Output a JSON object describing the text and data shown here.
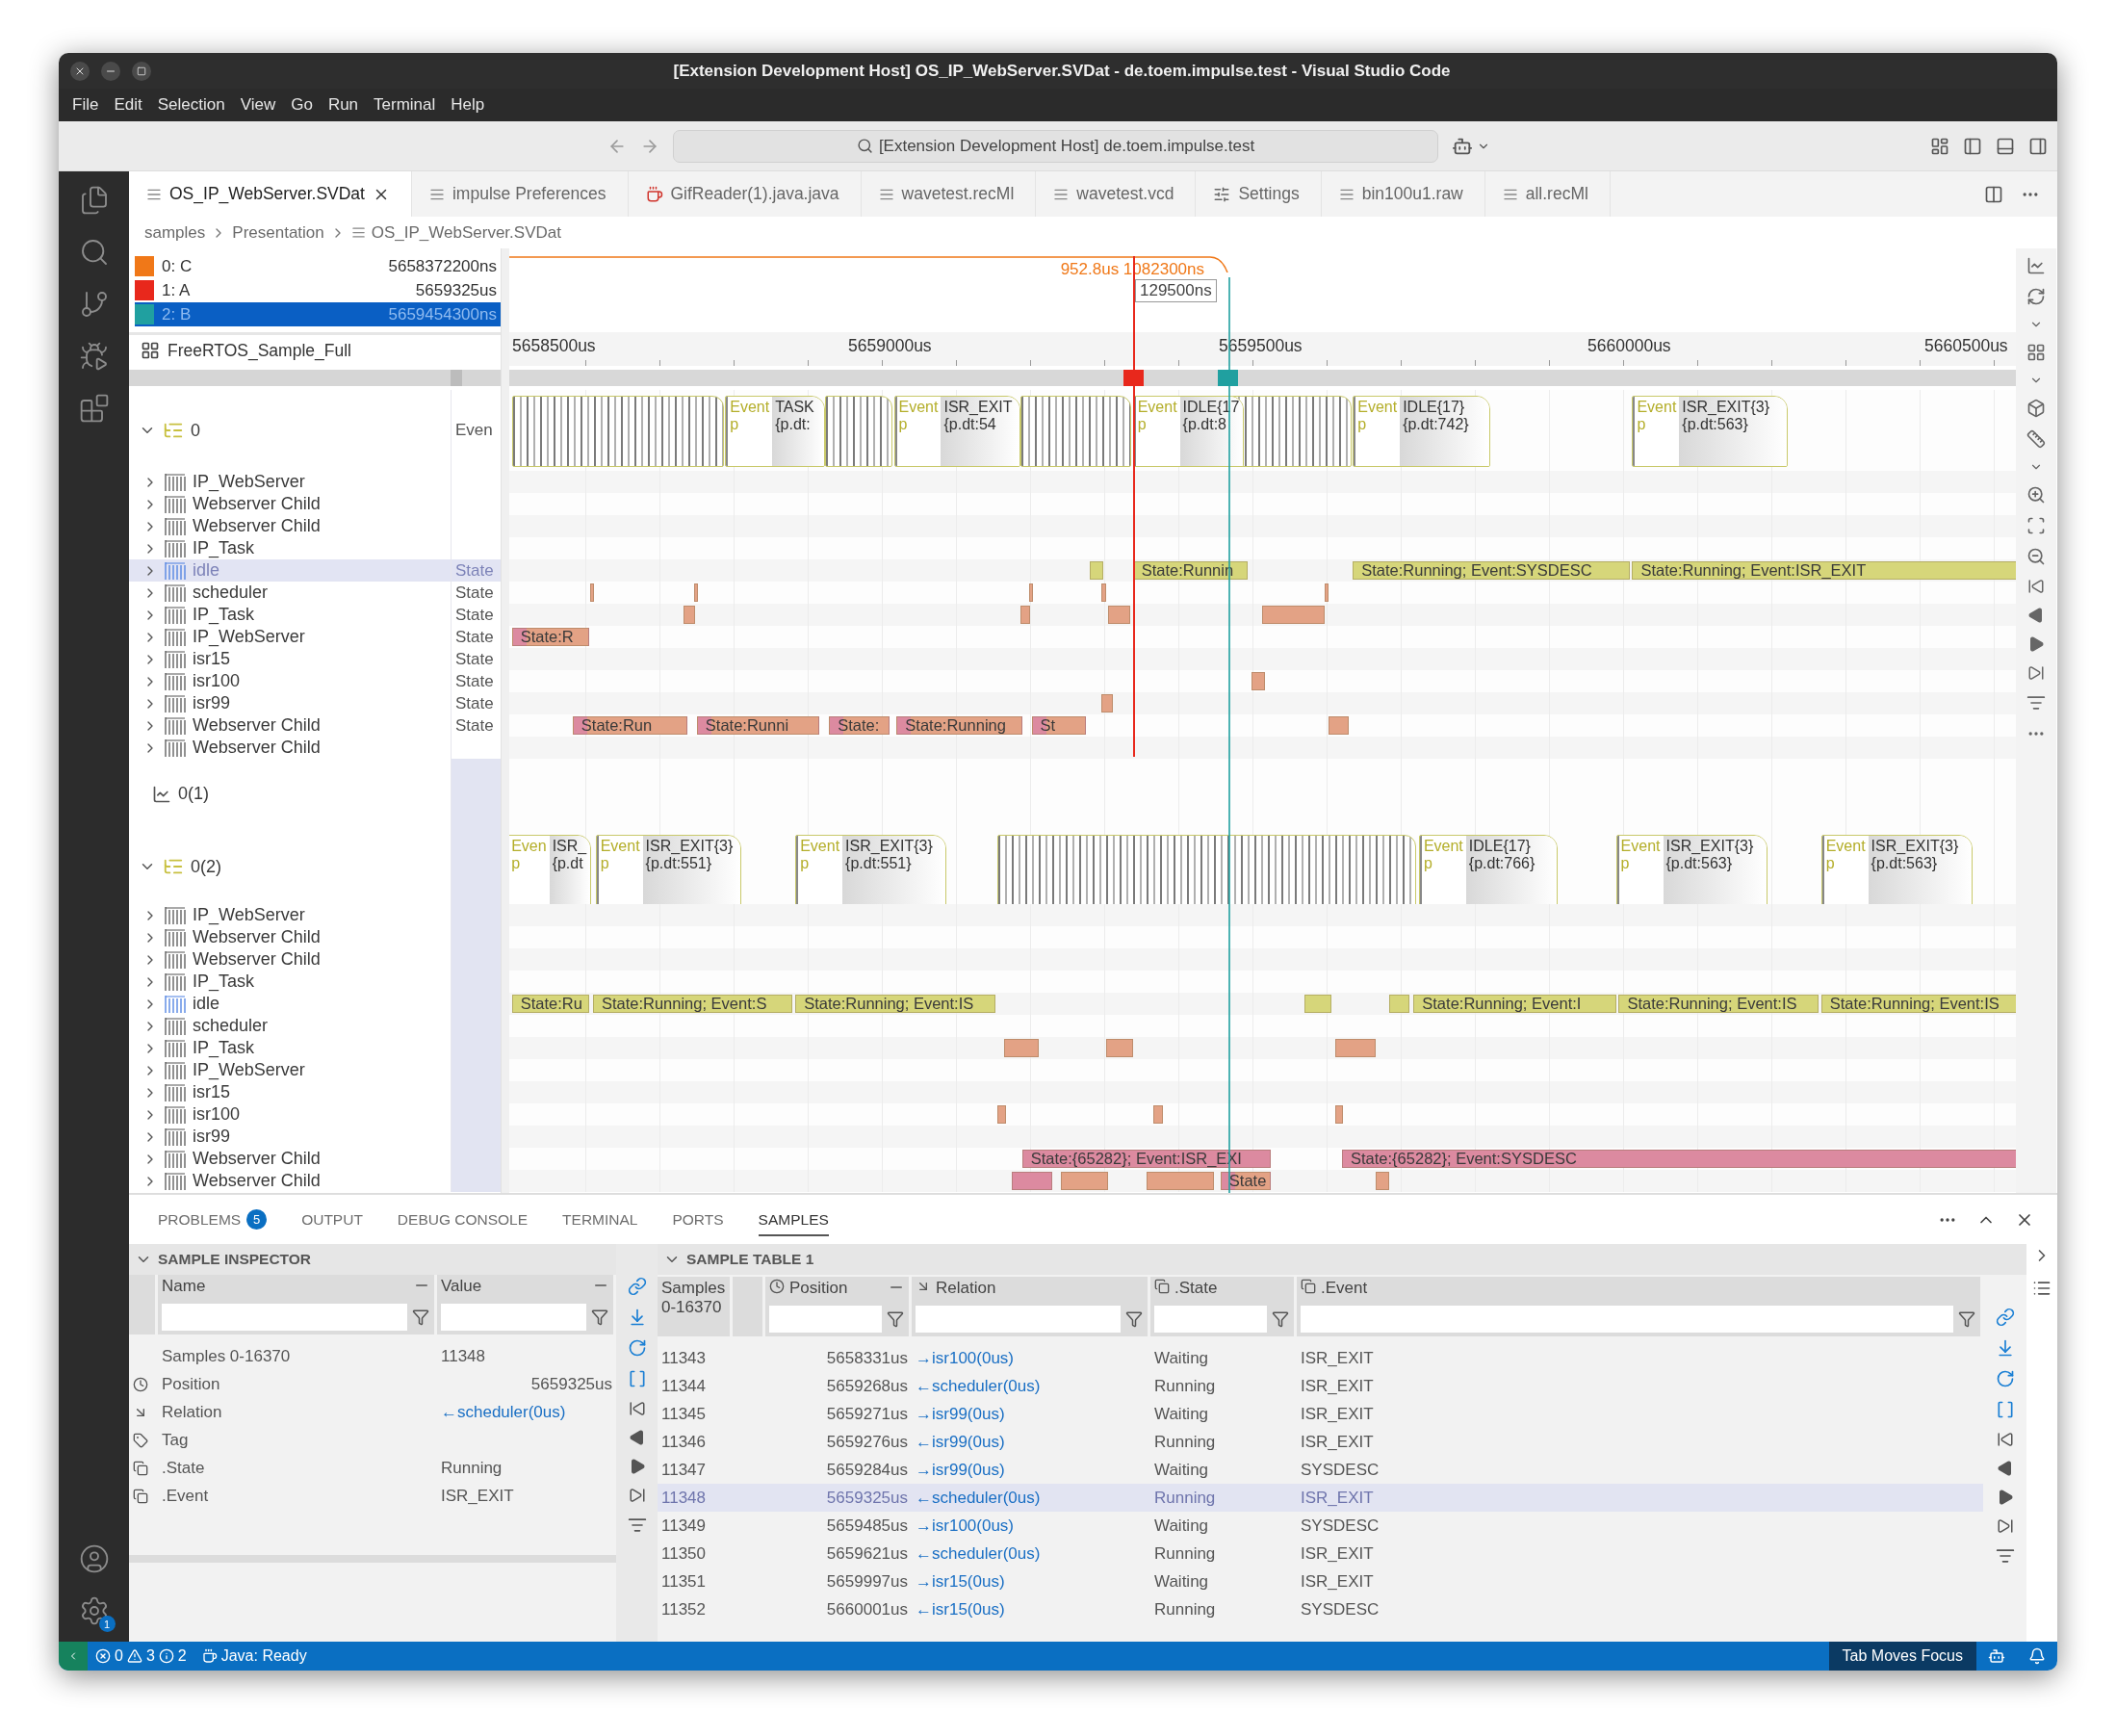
{
  "window": {
    "title": "[Extension Development Host] OS_IP_WebServer.SVDat - de.toem.impulse.test - Visual Studio Code"
  },
  "menu": [
    "File",
    "Edit",
    "Selection",
    "View",
    "Go",
    "Run",
    "Terminal",
    "Help"
  ],
  "command_center": {
    "text": "[Extension Development Host] de.toem.impulse.test"
  },
  "activity_bar": {
    "settings_badge": "1"
  },
  "tabs": [
    {
      "label": "OS_IP_WebServer.SVDat",
      "kind": "data",
      "selected": true
    },
    {
      "label": "impulse Preferences",
      "kind": "data",
      "selected": false
    },
    {
      "label": "GifReader(1).java.java",
      "kind": "java",
      "selected": false
    },
    {
      "label": "wavetest.recMl",
      "kind": "data",
      "selected": false
    },
    {
      "label": "wavetest.vcd",
      "kind": "data",
      "selected": false
    },
    {
      "label": "Settings",
      "kind": "settings",
      "selected": false
    },
    {
      "label": "bin100u1.raw",
      "kind": "data",
      "selected": false
    },
    {
      "label": "all.recMl",
      "kind": "data",
      "selected": false
    }
  ],
  "breadcrumb": [
    "samples",
    "Presentation",
    "OS_IP_WebServer.SVDat"
  ],
  "cursors": [
    {
      "name": "0: C",
      "value": "5658372200ns",
      "color": "#f07818",
      "selected": false
    },
    {
      "name": "1: A",
      "value": "5659325us",
      "color": "#e8281c",
      "selected": false
    },
    {
      "name": "2: B",
      "value": "5659454300ns",
      "color": "#20a0a0",
      "selected": true
    }
  ],
  "cursor_labels": {
    "delta": "952.8us 1082300ns",
    "span": "129500ns"
  },
  "document": {
    "name": "FreeRTOS_Sample_Full"
  },
  "ruler": [
    "5658500us",
    "5659000us",
    "5659500us",
    "5660000us",
    "5660500us"
  ],
  "tracks": [
    {
      "kind": "group",
      "label": "0",
      "expanded": true,
      "value": "Even",
      "events": [
        {
          "tag": "Event",
          "sub": "p",
          "name": "TASK",
          "detail": "{p.dt:"
        },
        {
          "tag": "Event",
          "sub": "p",
          "name": "ISR_EXIT",
          "detail": "{p.dt:54"
        },
        {
          "tag": "Event",
          "sub": "p",
          "name": "IDLE{17",
          "detail": "{p.dt:8"
        },
        {
          "tag": "Event",
          "sub": "p",
          "name": "IDLE{17}",
          "detail": "{p.dt:742}"
        },
        {
          "tag": "Event",
          "sub": "p",
          "name": "ISR_EXIT{3}",
          "detail": "{p.dt:563}"
        }
      ],
      "children": [
        {
          "label": "IP_WebServer",
          "selected": false
        },
        {
          "label": "Webserver Child",
          "selected": false
        },
        {
          "label": "Webserver Child",
          "selected": false
        },
        {
          "label": "IP_Task",
          "selected": false
        },
        {
          "label": "idle",
          "selected": true,
          "value": "State",
          "segments": [
            {
              "label": "State:Runnin",
              "kind": "state"
            },
            {
              "label": "State:Running; Event:SYSDESC",
              "kind": "state"
            },
            {
              "label": "State:Running; Event:ISR_EXIT",
              "kind": "state"
            }
          ]
        },
        {
          "label": "scheduler",
          "selected": false,
          "value": "State"
        },
        {
          "label": "IP_Task",
          "selected": false,
          "value": "State"
        },
        {
          "label": "IP_WebServer",
          "selected": false,
          "value": "State",
          "segments": [
            {
              "label": "State:R",
              "kind": "running"
            }
          ]
        },
        {
          "label": "isr15",
          "selected": false,
          "value": "State"
        },
        {
          "label": "isr100",
          "selected": false,
          "value": "State"
        },
        {
          "label": "isr99",
          "selected": false,
          "value": "State"
        },
        {
          "label": "Webserver Child",
          "selected": false,
          "value": "State",
          "segments": [
            {
              "label": "State:Run",
              "kind": "running"
            },
            {
              "label": "State:Runni",
              "kind": "running"
            },
            {
              "label": "State:",
              "kind": "running"
            },
            {
              "label": "State:Running",
              "kind": "running"
            },
            {
              "label": "St",
              "kind": "running"
            }
          ]
        },
        {
          "label": "Webserver Child",
          "selected": false
        }
      ]
    },
    {
      "kind": "graph",
      "label": "0(1)"
    },
    {
      "kind": "group",
      "label": "0(2)",
      "expanded": true,
      "events": [
        {
          "tag": "Even",
          "sub": "p",
          "name": "ISR_",
          "detail": "{p.dt"
        },
        {
          "tag": "Event",
          "sub": "p",
          "name": "ISR_EXIT{3}",
          "detail": "{p.dt:551}"
        },
        {
          "tag": "Event",
          "sub": "p",
          "name": "ISR_EXIT{3}",
          "detail": "{p.dt:551}"
        },
        {
          "tag": "Event",
          "sub": "p",
          "name": "IDLE{17}",
          "detail": "{p.dt:766}"
        },
        {
          "tag": "Event",
          "sub": "p",
          "name": "ISR_EXIT{3}",
          "detail": "{p.dt:563}"
        },
        {
          "tag": "Event",
          "sub": "p",
          "name": "ISR_EXIT{3}",
          "detail": "{p.dt:563}"
        }
      ],
      "children": [
        {
          "label": "IP_WebServer",
          "selected": false
        },
        {
          "label": "Webserver Child",
          "selected": false
        },
        {
          "label": "Webserver Child",
          "selected": false
        },
        {
          "label": "IP_Task",
          "selected": false
        },
        {
          "label": "idle",
          "selected": false,
          "segments": [
            {
              "label": "State:Ru",
              "kind": "state"
            },
            {
              "label": "State:Running; Event:S",
              "kind": "state"
            },
            {
              "label": "State:Running; Event:IS",
              "kind": "state"
            },
            {
              "label": "State:Running; Event:I",
              "kind": "state"
            },
            {
              "label": "State:Running; Event:IS",
              "kind": "state"
            },
            {
              "label": "State:Running; Event:IS",
              "kind": "state"
            }
          ]
        },
        {
          "label": "scheduler",
          "selected": false
        },
        {
          "label": "IP_Task",
          "selected": false
        },
        {
          "label": "IP_WebServer",
          "selected": false
        },
        {
          "label": "isr15",
          "selected": false
        },
        {
          "label": "isr100",
          "selected": false
        },
        {
          "label": "isr99",
          "selected": false
        },
        {
          "label": "Webserver Child",
          "selected": false,
          "segments": [
            {
              "label": "State:{65282}; Event:ISR_EXI",
              "kind": "pending"
            },
            {
              "label": "State:{65282}; Event:SYSDESC",
              "kind": "pending"
            }
          ]
        },
        {
          "label": "Webserver Child",
          "selected": false,
          "segments": [
            {
              "label": "State",
              "kind": "running"
            }
          ]
        }
      ]
    }
  ],
  "panel": {
    "tabs": [
      {
        "label": "PROBLEMS",
        "badge": "5",
        "selected": false
      },
      {
        "label": "OUTPUT",
        "selected": false
      },
      {
        "label": "DEBUG CONSOLE",
        "selected": false
      },
      {
        "label": "TERMINAL",
        "selected": false
      },
      {
        "label": "PORTS",
        "selected": false
      },
      {
        "label": "SAMPLES",
        "selected": true
      }
    ],
    "inspector": {
      "title": "SAMPLE INSPECTOR",
      "columns": [
        "Name",
        "Value"
      ],
      "rows": [
        {
          "name": "Samples 0-16370",
          "value": "11348",
          "kind": "plain"
        },
        {
          "name": "Position",
          "value": "5659325us",
          "kind": "position"
        },
        {
          "name": "Relation",
          "value": "←scheduler(0us)",
          "kind": "relation"
        },
        {
          "name": "Tag",
          "kind": "tag"
        },
        {
          "name": ".State",
          "value": "Running",
          "kind": "field"
        },
        {
          "name": ".Event",
          "value": "ISR_EXIT",
          "kind": "field"
        }
      ]
    },
    "table": {
      "title": "SAMPLE TABLE 1",
      "columns": [
        {
          "label": "Samples 0-16370",
          "kind": "index"
        },
        {
          "label": "Position",
          "kind": "position"
        },
        {
          "label": "Relation",
          "kind": "relation"
        },
        {
          "label": ".State",
          "kind": "field"
        },
        {
          "label": ".Event",
          "kind": "field"
        }
      ],
      "rows": [
        {
          "cells": [
            "11343",
            "5658331us",
            "→isr100(0us)",
            "Waiting",
            "ISR_EXIT"
          ],
          "selected": false
        },
        {
          "cells": [
            "11344",
            "5659268us",
            "←scheduler(0us)",
            "Running",
            "ISR_EXIT"
          ],
          "selected": false
        },
        {
          "cells": [
            "11345",
            "5659271us",
            "→isr99(0us)",
            "Waiting",
            "ISR_EXIT"
          ],
          "selected": false
        },
        {
          "cells": [
            "11346",
            "5659276us",
            "←isr99(0us)",
            "Running",
            "ISR_EXIT"
          ],
          "selected": false
        },
        {
          "cells": [
            "11347",
            "5659284us",
            "→isr99(0us)",
            "Waiting",
            "SYSDESC"
          ],
          "selected": false
        },
        {
          "cells": [
            "11348",
            "5659325us",
            "←scheduler(0us)",
            "Running",
            "ISR_EXIT"
          ],
          "selected": true
        },
        {
          "cells": [
            "11349",
            "5659485us",
            "→isr100(0us)",
            "Waiting",
            "SYSDESC"
          ],
          "selected": false
        },
        {
          "cells": [
            "11350",
            "5659621us",
            "←scheduler(0us)",
            "Running",
            "ISR_EXIT"
          ],
          "selected": false
        },
        {
          "cells": [
            "11351",
            "5659997us",
            "→isr15(0us)",
            "Waiting",
            "ISR_EXIT"
          ],
          "selected": false
        },
        {
          "cells": [
            "11352",
            "5660001us",
            "←isr15(0us)",
            "Running",
            "SYSDESC"
          ],
          "selected": false
        }
      ]
    }
  },
  "status_bar": {
    "problems": [
      {
        "kind": "error",
        "count": "0"
      },
      {
        "kind": "warning",
        "count": "3"
      },
      {
        "kind": "info",
        "count": "2"
      }
    ],
    "java": "Java: Ready",
    "focus": "Tab Moves Focus"
  }
}
